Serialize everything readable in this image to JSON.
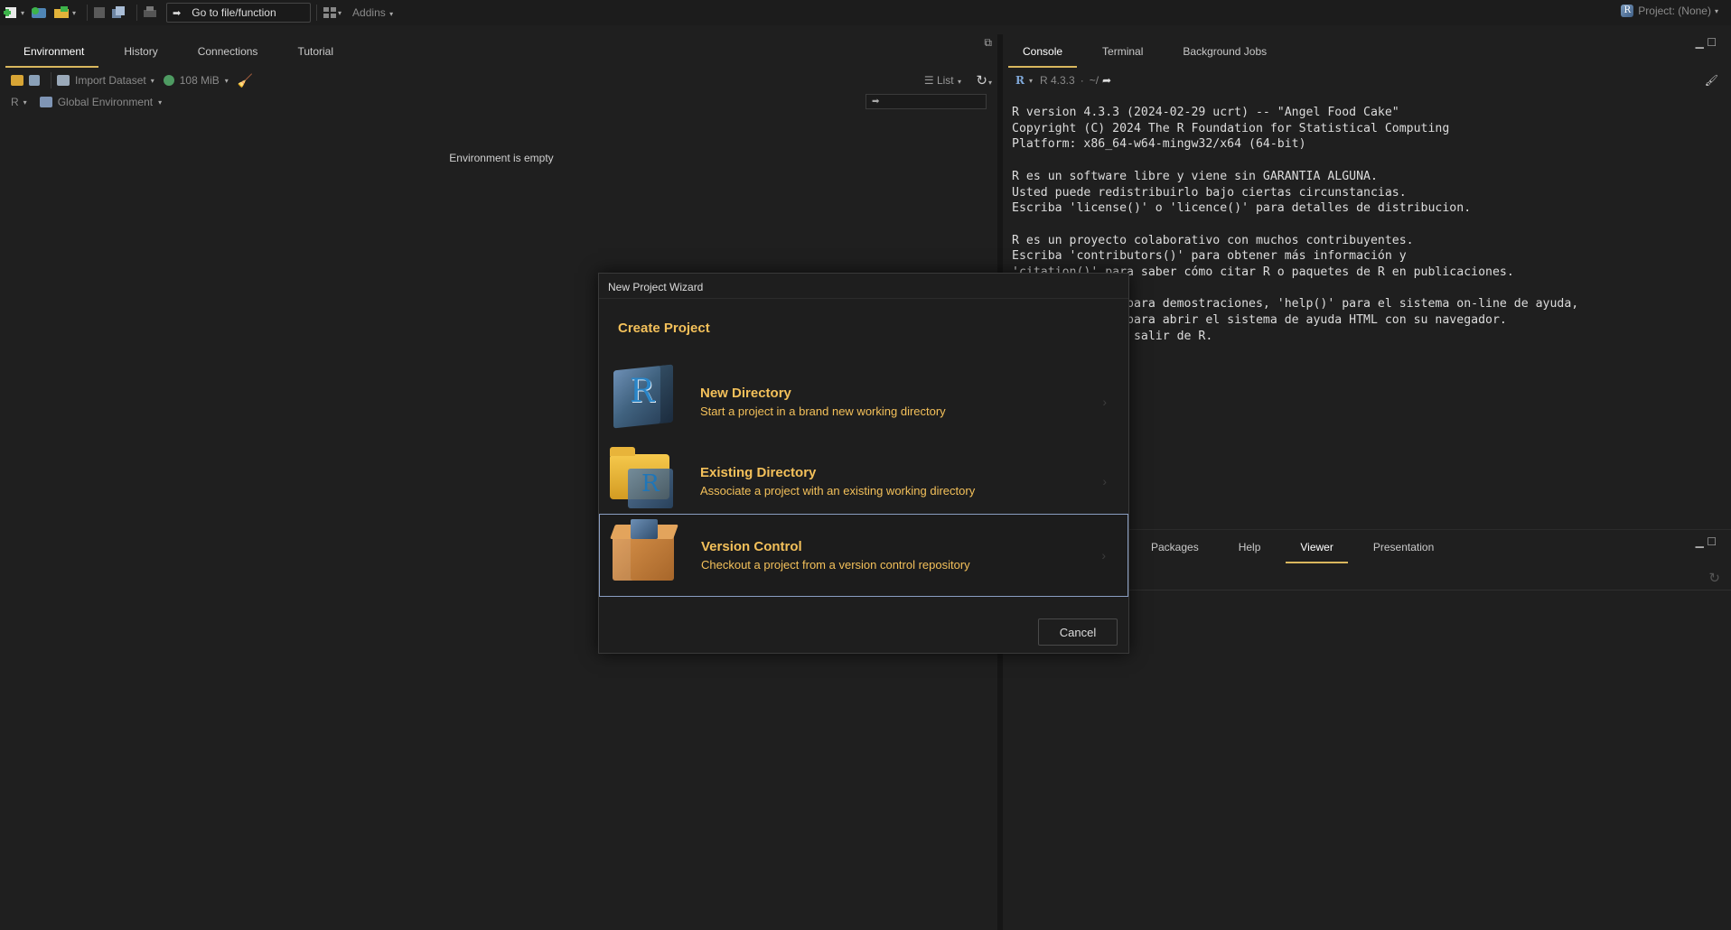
{
  "toolbar": {
    "goto_label": "Go to file/function",
    "addins_label": "Addins",
    "project_label": "Project: (None)"
  },
  "env_pane": {
    "tabs": [
      "Environment",
      "History",
      "Connections",
      "Tutorial"
    ],
    "import_label": "Import Dataset",
    "memory_label": "108 MiB",
    "list_label": "List",
    "r_label": "R",
    "scope_label": "Global Environment",
    "empty_message": "Environment is empty"
  },
  "console_pane": {
    "tabs": [
      "Console",
      "Terminal",
      "Background Jobs"
    ],
    "r_version_label": "R 4.3.3",
    "path_label": "~/",
    "lines": [
      "R version 4.3.3 (2024-02-29 ucrt) -- \"Angel Food Cake\"",
      "Copyright (C) 2024 The R Foundation for Statistical Computing",
      "Platform: x86_64-w64-mingw32/x64 (64-bit)",
      "",
      "R es un software libre y viene sin GARANTIA ALGUNA.",
      "Usted puede redistribuirlo bajo ciertas circunstancias.",
      "Escriba 'license()' o 'licence()' para detalles de distribucion.",
      "",
      "R es un proyecto colaborativo con muchos contribuyentes.",
      "Escriba 'contributors()' para obtener más información y",
      "'citation()' para saber cómo citar R o paquetes de R en publicaciones.",
      "",
      "                para demostraciones, 'help()' para el sistema on-line de ayuda,",
      "                para abrir el sistema de ayuda HTML con su navegador.",
      "              ra salir de R."
    ]
  },
  "viewer_pane": {
    "tabs": [
      "Packages",
      "Help",
      "Viewer",
      "Presentation"
    ]
  },
  "modal": {
    "title": "New Project Wizard",
    "heading": "Create Project",
    "options": [
      {
        "title": "New Directory",
        "desc": "Start a project in a brand new working directory"
      },
      {
        "title": "Existing Directory",
        "desc": "Associate a project with an existing working directory"
      },
      {
        "title": "Version Control",
        "desc": "Checkout a project from a version control repository"
      }
    ],
    "cancel_label": "Cancel"
  },
  "colors": {
    "accent": "#f3c05a",
    "tab_underline": "#d9b75e",
    "selected_border": "#8a9ec2"
  }
}
